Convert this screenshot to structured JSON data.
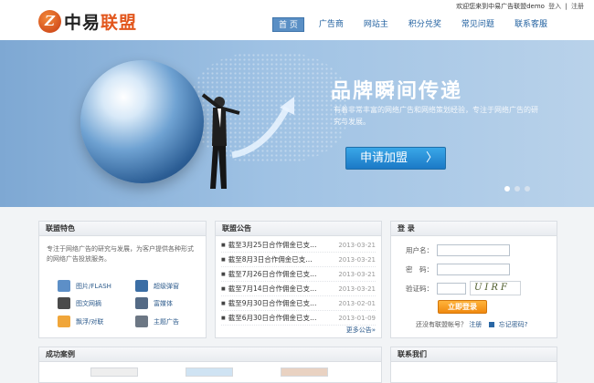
{
  "header": {
    "logo_mark": "Z",
    "logo_a": "中易",
    "logo_b": "联盟",
    "welcome": "欢迎您来到中易广告联盟demo",
    "login_link": "登入",
    "sep": "|",
    "register_link": "注册"
  },
  "nav": [
    "首 页",
    "广告商",
    "网站主",
    "积分兑奖",
    "常见问题",
    "联系客服"
  ],
  "banner": {
    "title": "品牌瞬间传递",
    "desc": "有着非常丰富的网络广告和网络策划经验，专注于网络广告的研究与发展。",
    "apply": "申请加盟",
    "apply_arrow": "〉"
  },
  "features": {
    "title": "联盟特色",
    "desc": "专注于网络广告的研究与发展，为客户提供各种形式的网络广告投放服务。",
    "items": [
      {
        "label": "图片/FLASH",
        "icon": "image-flash-icon",
        "color": "#5d8fc7"
      },
      {
        "label": "超级弹窗",
        "icon": "popup-window-icon",
        "color": "#3b6ea5"
      },
      {
        "label": "图文网摘",
        "icon": "image-text-icon",
        "color": "#4a4a4a"
      },
      {
        "label": "富媒体",
        "icon": "rich-media-icon",
        "color": "#546a85"
      },
      {
        "label": "飘浮/对联",
        "icon": "float-couplet-icon",
        "color": "#f0a63a"
      },
      {
        "label": "主题广告",
        "icon": "theme-ad-icon",
        "color": "#6c7784"
      }
    ]
  },
  "news": {
    "title": "联盟公告",
    "items": [
      {
        "text": "截至3月25日合作佣金已支…",
        "date": "2013-03-21"
      },
      {
        "text": "截至8月3日合作佣金已支…",
        "date": "2013-03-21"
      },
      {
        "text": "截至7月26日合作佣金已支…",
        "date": "2013-03-21"
      },
      {
        "text": "截至7月14日合作佣金已支…",
        "date": "2013-03-21"
      },
      {
        "text": "截至9月30日合作佣金已支…",
        "date": "2013-02-01"
      },
      {
        "text": "截至6月30日合作佣金已支…",
        "date": "2013-01-09"
      }
    ],
    "more": "更多公告»"
  },
  "login": {
    "title": "登 录",
    "username_label": "用户名：",
    "password_label": "密　码：",
    "captcha_label": "验证码：",
    "captcha_text": "UIRF",
    "submit": "立即登录",
    "no_account": "还没有联盟帐号？",
    "register": "注册",
    "forgot": "忘记密码?"
  },
  "cases": {
    "title": "成功案例"
  },
  "contact": {
    "title": "联系我们"
  }
}
